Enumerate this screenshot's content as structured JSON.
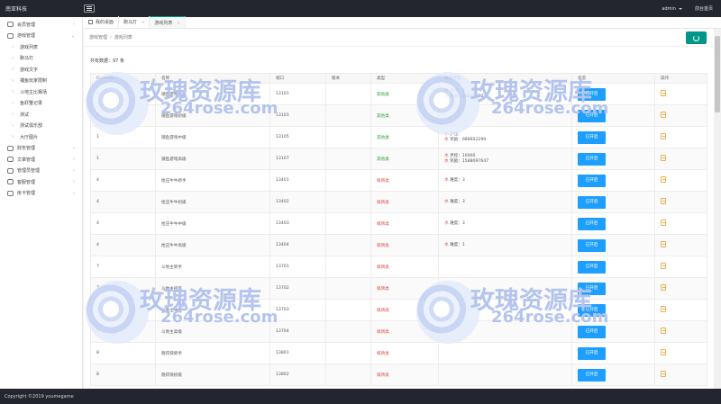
{
  "topbar": {
    "brand": "南亚科技",
    "user": "admin",
    "home_link": "前台首页"
  },
  "sidebar": {
    "items": [
      {
        "label": "会员管理",
        "kind": "group",
        "arrow": "‹"
      },
      {
        "label": "游戏管理",
        "kind": "group",
        "arrow": "⌄"
      },
      {
        "label": "游戏列表",
        "kind": "sub"
      },
      {
        "label": "跑马灯",
        "kind": "sub"
      },
      {
        "label": "游戏文字",
        "kind": "sub"
      },
      {
        "label": "捕鱼玩家限制",
        "kind": "sub"
      },
      {
        "label": "斗地主比赛场",
        "kind": "sub"
      },
      {
        "label": "鱼虾蟹记录",
        "kind": "sub"
      },
      {
        "label": "测试",
        "kind": "sub"
      },
      {
        "label": "测试俱乐部",
        "kind": "sub"
      },
      {
        "label": "大厅图片",
        "kind": "sub"
      },
      {
        "label": "财务管理",
        "kind": "group",
        "arrow": "‹"
      },
      {
        "label": "文章管理",
        "kind": "group",
        "arrow": "‹"
      },
      {
        "label": "管理员管理",
        "kind": "group",
        "arrow": "‹"
      },
      {
        "label": "客服管理",
        "kind": "group",
        "arrow": "‹"
      },
      {
        "label": "房卡管理",
        "kind": "group",
        "arrow": "‹"
      }
    ]
  },
  "tabs": [
    {
      "label": "我的桌面",
      "active": false,
      "closable": false
    },
    {
      "label": "跑马灯",
      "active": false,
      "closable": true
    },
    {
      "label": "游戏列表",
      "active": true,
      "closable": true
    }
  ],
  "breadcrumb": {
    "parent": "游戏管理",
    "separator": "/",
    "current": "游戏列表"
  },
  "count_text": "共有数据：97 条",
  "table": {
    "headers": [
      "GameID",
      "名称",
      "端口",
      "版本",
      "类型",
      "库存管理",
      "状态",
      "操作"
    ],
    "rows": [
      {
        "gameid": "1",
        "name": "捕鱼游戏新手",
        "port": "13101",
        "version": "",
        "type": "其他类",
        "type_kind": "open",
        "inventory": [
          {
            "key": "水",
            "label": "步控：1"
          },
          {
            "key": "水",
            "label": "奖励：36835750"
          }
        ],
        "status": "已开启"
      },
      {
        "gameid": "1",
        "name": "捕鱼游戏初级",
        "port": "13103",
        "version": "",
        "type": "其他类",
        "type_kind": "open",
        "inventory": [],
        "status": "已开启"
      },
      {
        "gameid": "1",
        "name": "捕鱼游戏中级",
        "port": "13105",
        "version": "",
        "type": "其他类",
        "type_kind": "open",
        "inventory": [
          {
            "key": "水",
            "label": "步控："
          },
          {
            "key": "水",
            "label": "奖励：988602299"
          }
        ],
        "status": "已开启"
      },
      {
        "gameid": "1",
        "name": "捕鱼游戏高级",
        "port": "13107",
        "version": "",
        "type": "其他类",
        "type_kind": "open",
        "inventory": [
          {
            "key": "水",
            "label": "步控：10000"
          },
          {
            "key": "水",
            "label": "奖励：1588097647"
          }
        ],
        "status": "已开启"
      },
      {
        "gameid": "4",
        "name": "抢庄牛牛新手",
        "port": "13401",
        "version": "",
        "type": "棋牌类",
        "type_kind": "room",
        "inventory": [
          {
            "key": "水",
            "label": "难度：3"
          }
        ],
        "status": "已开启"
      },
      {
        "gameid": "4",
        "name": "抢庄牛牛初级",
        "port": "13402",
        "version": "",
        "type": "棋牌类",
        "type_kind": "room",
        "inventory": [
          {
            "key": "水",
            "label": "难度：3"
          }
        ],
        "status": "已开启"
      },
      {
        "gameid": "4",
        "name": "抢庄牛牛中级",
        "port": "13403",
        "version": "",
        "type": "棋牌类",
        "type_kind": "room",
        "inventory": [
          {
            "key": "水",
            "label": "难度：3"
          }
        ],
        "status": "已开启"
      },
      {
        "gameid": "4",
        "name": "抢庄牛牛高级",
        "port": "13404",
        "version": "",
        "type": "棋牌类",
        "type_kind": "room",
        "inventory": [
          {
            "key": "水",
            "label": "难度：1"
          }
        ],
        "status": "已开启"
      },
      {
        "gameid": "7",
        "name": "斗地主新手",
        "port": "13701",
        "version": "",
        "type": "棋牌类",
        "type_kind": "room",
        "inventory": [],
        "status": "已开启"
      },
      {
        "gameid": "7",
        "name": "斗地主初级",
        "port": "13702",
        "version": "",
        "type": "棋牌类",
        "type_kind": "room",
        "inventory": [],
        "status": "已开启"
      },
      {
        "gameid": "7",
        "name": "斗地主中级",
        "port": "13703",
        "version": "",
        "type": "棋牌类",
        "type_kind": "room",
        "inventory": [],
        "status": "已开启"
      },
      {
        "gameid": "7",
        "name": "斗地主高级",
        "port": "13704",
        "version": "",
        "type": "棋牌类",
        "type_kind": "room",
        "inventory": [],
        "status": "已开启"
      },
      {
        "gameid": "8",
        "name": "跑得快新手",
        "port": "13801",
        "version": "",
        "type": "棋牌类",
        "type_kind": "room",
        "inventory": [],
        "status": "已开启"
      },
      {
        "gameid": "8",
        "name": "跑得快初级",
        "port": "13802",
        "version": "",
        "type": "棋牌类",
        "type_kind": "room",
        "inventory": [],
        "status": "已开启"
      }
    ]
  },
  "watermark": {
    "title": "玫瑰资源库",
    "subtitle": "264rose.com"
  },
  "footer": {
    "copyright": "Copyright ©2019 youmegame"
  },
  "colors": {
    "topbar": "#23262e",
    "accent": "#009688",
    "button": "#1e9fff",
    "type_open": "#2e9e3e",
    "type_room": "#d9534f"
  }
}
